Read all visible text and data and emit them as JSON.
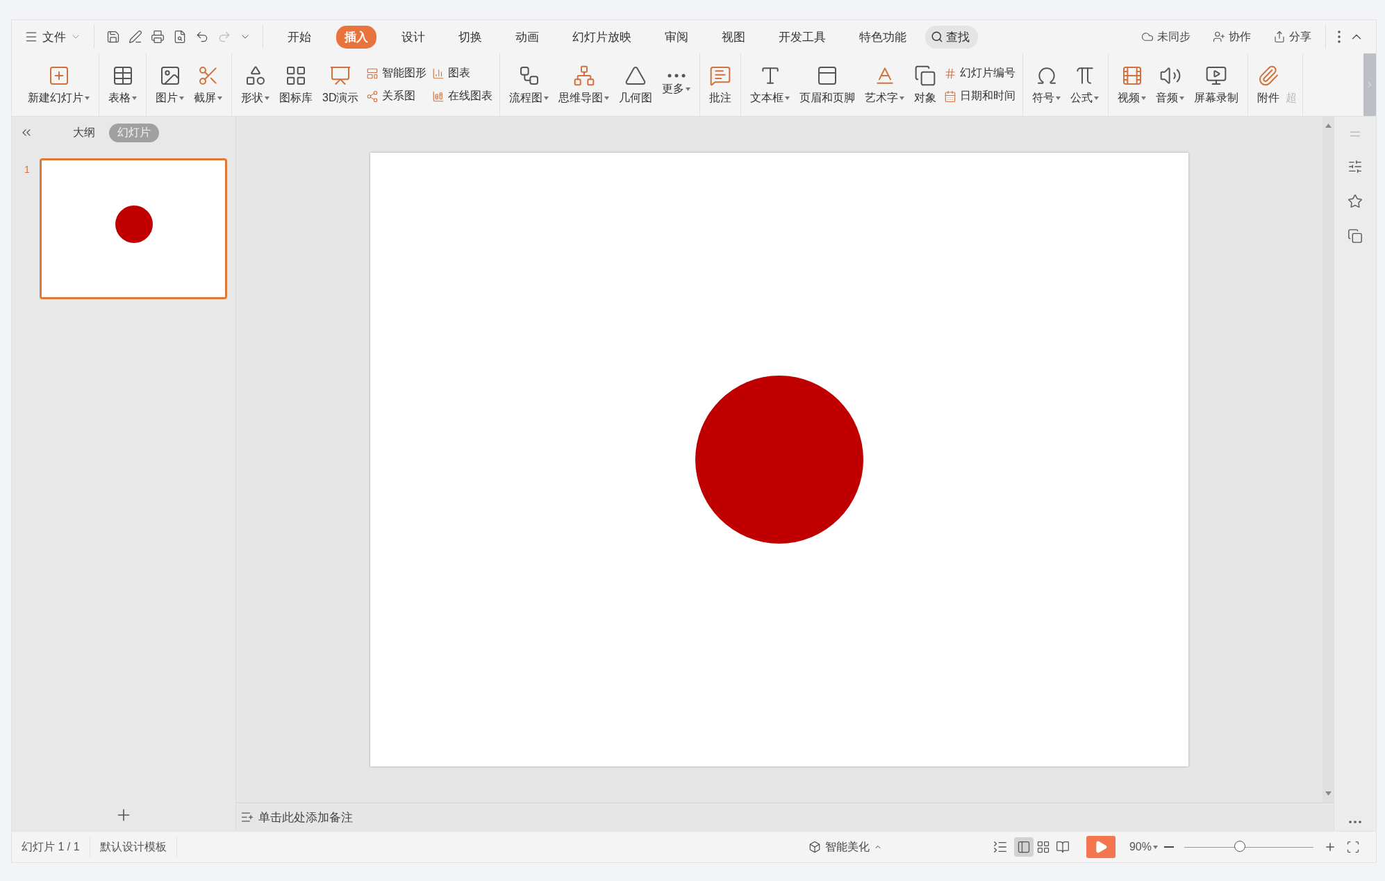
{
  "menu": {
    "file": "文件",
    "tabs": [
      {
        "label": "开始",
        "selected": false
      },
      {
        "label": "插入",
        "selected": true
      },
      {
        "label": "设计",
        "selected": false
      },
      {
        "label": "切换",
        "selected": false
      },
      {
        "label": "动画",
        "selected": false
      },
      {
        "label": "幻灯片放映",
        "selected": false
      },
      {
        "label": "审阅",
        "selected": false
      },
      {
        "label": "视图",
        "selected": false
      },
      {
        "label": "开发工具",
        "selected": false
      },
      {
        "label": "特色功能",
        "selected": false
      }
    ],
    "search": "查找",
    "actions": [
      "未同步",
      "协作",
      "分享"
    ]
  },
  "ribbon": {
    "groups": [
      [
        {
          "label": "新建幻灯片",
          "kind": "large",
          "dropdown": true
        }
      ],
      [
        {
          "label": "表格",
          "kind": "large",
          "dropdown": true
        }
      ],
      [
        {
          "label": "图片",
          "kind": "large",
          "dropdown": true
        },
        {
          "label": "截屏",
          "kind": "large",
          "dropdown": true
        }
      ],
      [
        {
          "label": "形状",
          "kind": "large",
          "dropdown": true
        },
        {
          "label": "图标库",
          "kind": "large",
          "dropdown": false
        },
        {
          "label": "3D演示",
          "kind": "large",
          "dropdown": false
        },
        {
          "label": "智能图形",
          "kind": "small"
        },
        {
          "label": "关系图",
          "kind": "small"
        },
        {
          "label": "图表",
          "kind": "small"
        },
        {
          "label": "在线图表",
          "kind": "small"
        }
      ],
      [
        {
          "label": "流程图",
          "kind": "large",
          "dropdown": true
        },
        {
          "label": "思维导图",
          "kind": "large",
          "dropdown": true
        },
        {
          "label": "几何图",
          "kind": "large",
          "dropdown": false
        },
        {
          "label": "更多",
          "kind": "large",
          "dropdown": true
        }
      ],
      [
        {
          "label": "批注",
          "kind": "large",
          "dropdown": false
        }
      ],
      [
        {
          "label": "文本框",
          "kind": "large",
          "dropdown": true
        },
        {
          "label": "页眉和页脚",
          "kind": "large",
          "dropdown": false
        },
        {
          "label": "艺术字",
          "kind": "large",
          "dropdown": true
        },
        {
          "label": "对象",
          "kind": "large",
          "dropdown": false
        },
        {
          "label": "幻灯片编号",
          "kind": "small"
        },
        {
          "label": "日期和时间",
          "kind": "small"
        }
      ],
      [
        {
          "label": "符号",
          "kind": "large",
          "dropdown": true
        },
        {
          "label": "公式",
          "kind": "large",
          "dropdown": true
        }
      ],
      [
        {
          "label": "视频",
          "kind": "large",
          "dropdown": true
        },
        {
          "label": "音频",
          "kind": "large",
          "dropdown": true
        },
        {
          "label": "屏幕录制",
          "kind": "large",
          "dropdown": false
        }
      ],
      [
        {
          "label": "附件",
          "kind": "large",
          "dropdown": false
        },
        {
          "label": "超",
          "kind": "cut"
        }
      ]
    ]
  },
  "panel": {
    "tabs": [
      {
        "label": "大纲",
        "selected": false
      },
      {
        "label": "幻灯片",
        "selected": true
      }
    ],
    "slides": [
      {
        "number": "1",
        "selected": true
      }
    ]
  },
  "notes": {
    "prompt": "单击此处添加备注"
  },
  "status": {
    "slide_count": "幻灯片 1 / 1",
    "template": "默认设计模板",
    "beautify": "智能美化",
    "views": [
      {
        "selected": true
      },
      {
        "selected": false
      },
      {
        "selected": false
      }
    ],
    "zoom": "90%",
    "zoom_slider": {
      "level": 0.43
    }
  }
}
